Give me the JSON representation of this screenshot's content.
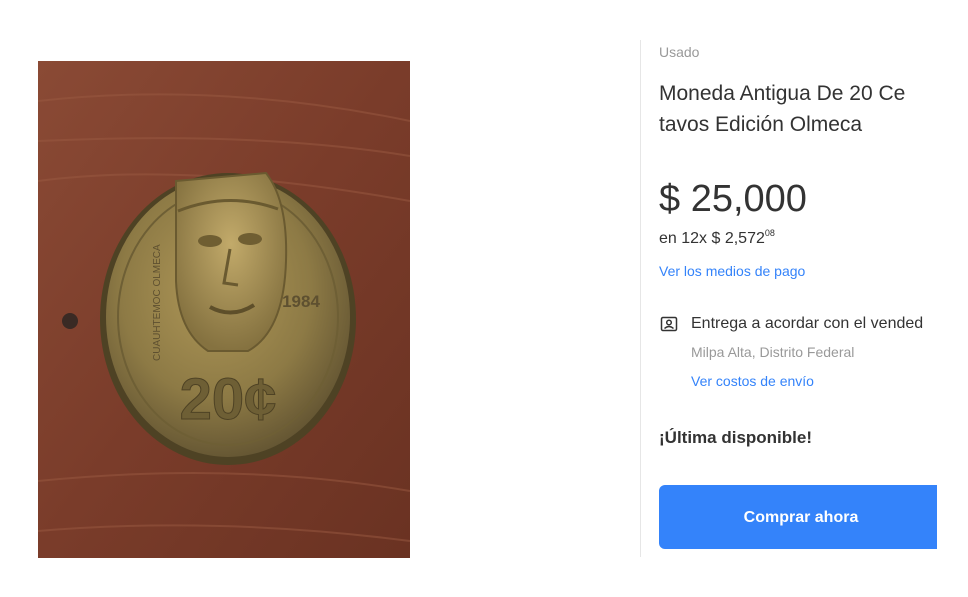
{
  "product": {
    "condition": "Usado",
    "title_line1": "Moneda Antigua De 20 Ce",
    "title_line2": "tavos Edición Olmeca",
    "price": "$ 25,000",
    "installments_prefix": "en 12x $ 2,572",
    "installments_cents": "08",
    "payment_methods_link": "Ver los medios de pago"
  },
  "shipping": {
    "icon": "store-pickup-icon",
    "title": "Entrega a acordar con el vended",
    "location": "Milpa Alta, Distrito Federal",
    "costs_link": "Ver costos de envío"
  },
  "stock_text": "¡Última disponible!",
  "buy_button_label": "Comprar ahora",
  "coin_image": {
    "denomination": "20¢",
    "year": "1984",
    "edge_text_left": "CUAUHTEMOC OLMECA"
  },
  "colors": {
    "accent": "#3483fa",
    "text": "#333333",
    "muted": "#999999"
  }
}
